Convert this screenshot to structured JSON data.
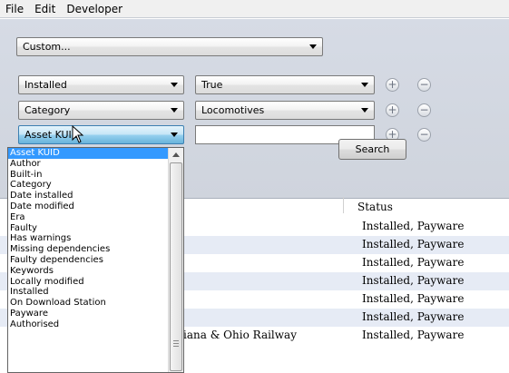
{
  "menubar": {
    "items": [
      "File",
      "Edit",
      "Developer"
    ]
  },
  "filters": {
    "preset": "Custom...",
    "rows": [
      {
        "field": "Installed",
        "value": "True"
      },
      {
        "field": "Category",
        "value": "Locomotives"
      },
      {
        "field": "Asset KUID",
        "value": ""
      }
    ],
    "add_glyph": "+",
    "remove_glyph": "−",
    "search_label": "Search"
  },
  "dropdown": {
    "options": [
      "Asset KUID",
      "Author",
      "Built-in",
      "Category",
      "Date installed",
      "Date modified",
      "Era",
      "Faulty",
      "Has warnings",
      "Missing dependencies",
      "Faulty dependencies",
      "Keywords",
      "Locally modified",
      "Installed",
      "On Download Station",
      "Payware",
      "Authorised"
    ],
    "selected_index": 0
  },
  "results": {
    "status_header": "Status",
    "rows": [
      {
        "name": "",
        "status": "Installed, Payware"
      },
      {
        "name": "",
        "status": "Installed, Payware"
      },
      {
        "name": "",
        "status": "Installed, Payware"
      },
      {
        "name": "",
        "status": "Installed, Payware"
      },
      {
        "name": "",
        "status": "Installed, Payware"
      },
      {
        "name": "",
        "status": "Installed, Payware"
      },
      {
        "name": "iana & Ohio Railway",
        "status": "Installed, Payware"
      }
    ]
  },
  "colors": {
    "selection": "#3399ff",
    "alt_row": "#e6ebf5",
    "panel": "#d6dbe5"
  }
}
